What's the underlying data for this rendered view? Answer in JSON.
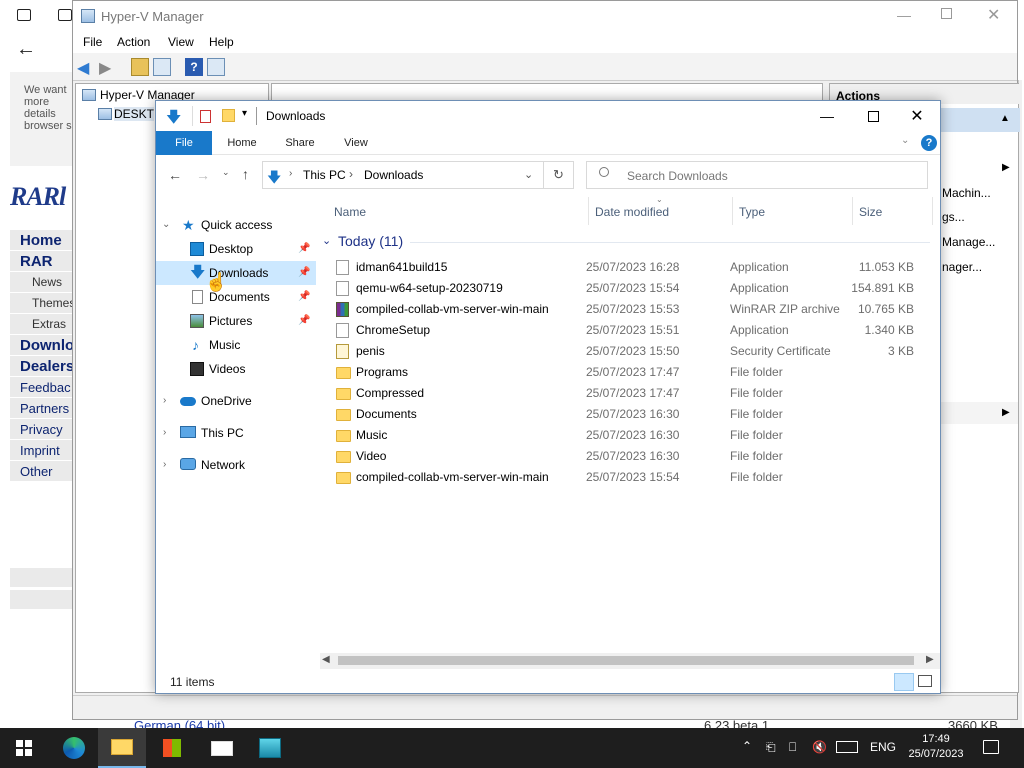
{
  "browser": {
    "rar_intro": "We want more details browser s",
    "rar_logo": "RARl",
    "nav": [
      "Home",
      "RAR",
      "News",
      "Themes",
      "Extras",
      "Downlo",
      "Dealers",
      "Feedbac",
      "Partners",
      "Privacy",
      "Imprint",
      "Other"
    ],
    "bottom_link": "German (64 bit)",
    "bottom_version": "6.23 beta 1",
    "bottom_size": "3660 KB"
  },
  "hyperv": {
    "title": "Hyper-V Manager",
    "menu": [
      "File",
      "Action",
      "View",
      "Help"
    ],
    "tree_root": "Hyper-V Manager",
    "tree_child": "DESKTO",
    "actions_header": "Actions",
    "actions_items": [
      "Machin...",
      "gs...",
      "Manage...",
      "nager..."
    ]
  },
  "explorer": {
    "title": "Downloads",
    "ribbon_tabs": [
      "File",
      "Home",
      "Share",
      "View"
    ],
    "breadcrumb": [
      "This PC",
      "Downloads"
    ],
    "search_placeholder": "Search Downloads",
    "nav": {
      "quick_access": "Quick access",
      "desktop": "Desktop",
      "downloads": "Downloads",
      "documents": "Documents",
      "pictures": "Pictures",
      "music": "Music",
      "videos": "Videos",
      "onedrive": "OneDrive",
      "thispc": "This PC",
      "network": "Network"
    },
    "columns": [
      "Name",
      "Date modified",
      "Type",
      "Size"
    ],
    "group_title": "Today (11)",
    "files": [
      {
        "name": "idman641build15",
        "date": "25/07/2023 16:28",
        "type": "Application",
        "size": "11.053 KB",
        "icon": "app"
      },
      {
        "name": "qemu-w64-setup-20230719",
        "date": "25/07/2023 15:54",
        "type": "Application",
        "size": "154.891 KB",
        "icon": "setup"
      },
      {
        "name": "compiled-collab-vm-server-win-main",
        "date": "25/07/2023 15:53",
        "type": "WinRAR ZIP archive",
        "size": "10.765 KB",
        "icon": "rar"
      },
      {
        "name": "ChromeSetup",
        "date": "25/07/2023 15:51",
        "type": "Application",
        "size": "1.340 KB",
        "icon": "app"
      },
      {
        "name": "penis",
        "date": "25/07/2023 15:50",
        "type": "Security Certificate",
        "size": "3 KB",
        "icon": "cert"
      },
      {
        "name": "Programs",
        "date": "25/07/2023 17:47",
        "type": "File folder",
        "size": "",
        "icon": "folder"
      },
      {
        "name": "Compressed",
        "date": "25/07/2023 17:47",
        "type": "File folder",
        "size": "",
        "icon": "folder"
      },
      {
        "name": "Documents",
        "date": "25/07/2023 16:30",
        "type": "File folder",
        "size": "",
        "icon": "folder"
      },
      {
        "name": "Music",
        "date": "25/07/2023 16:30",
        "type": "File folder",
        "size": "",
        "icon": "folder"
      },
      {
        "name": "Video",
        "date": "25/07/2023 16:30",
        "type": "File folder",
        "size": "",
        "icon": "folder"
      },
      {
        "name": "compiled-collab-vm-server-win-main",
        "date": "25/07/2023 15:54",
        "type": "File folder",
        "size": "",
        "icon": "folder"
      }
    ],
    "status": "11 items"
  },
  "taskbar": {
    "lang": "ENG",
    "time": "17:49",
    "date": "25/07/2023"
  },
  "colors": {
    "accent": "#1979ca",
    "selection": "#cce8ff",
    "taskbar": "#1e1e1e"
  }
}
